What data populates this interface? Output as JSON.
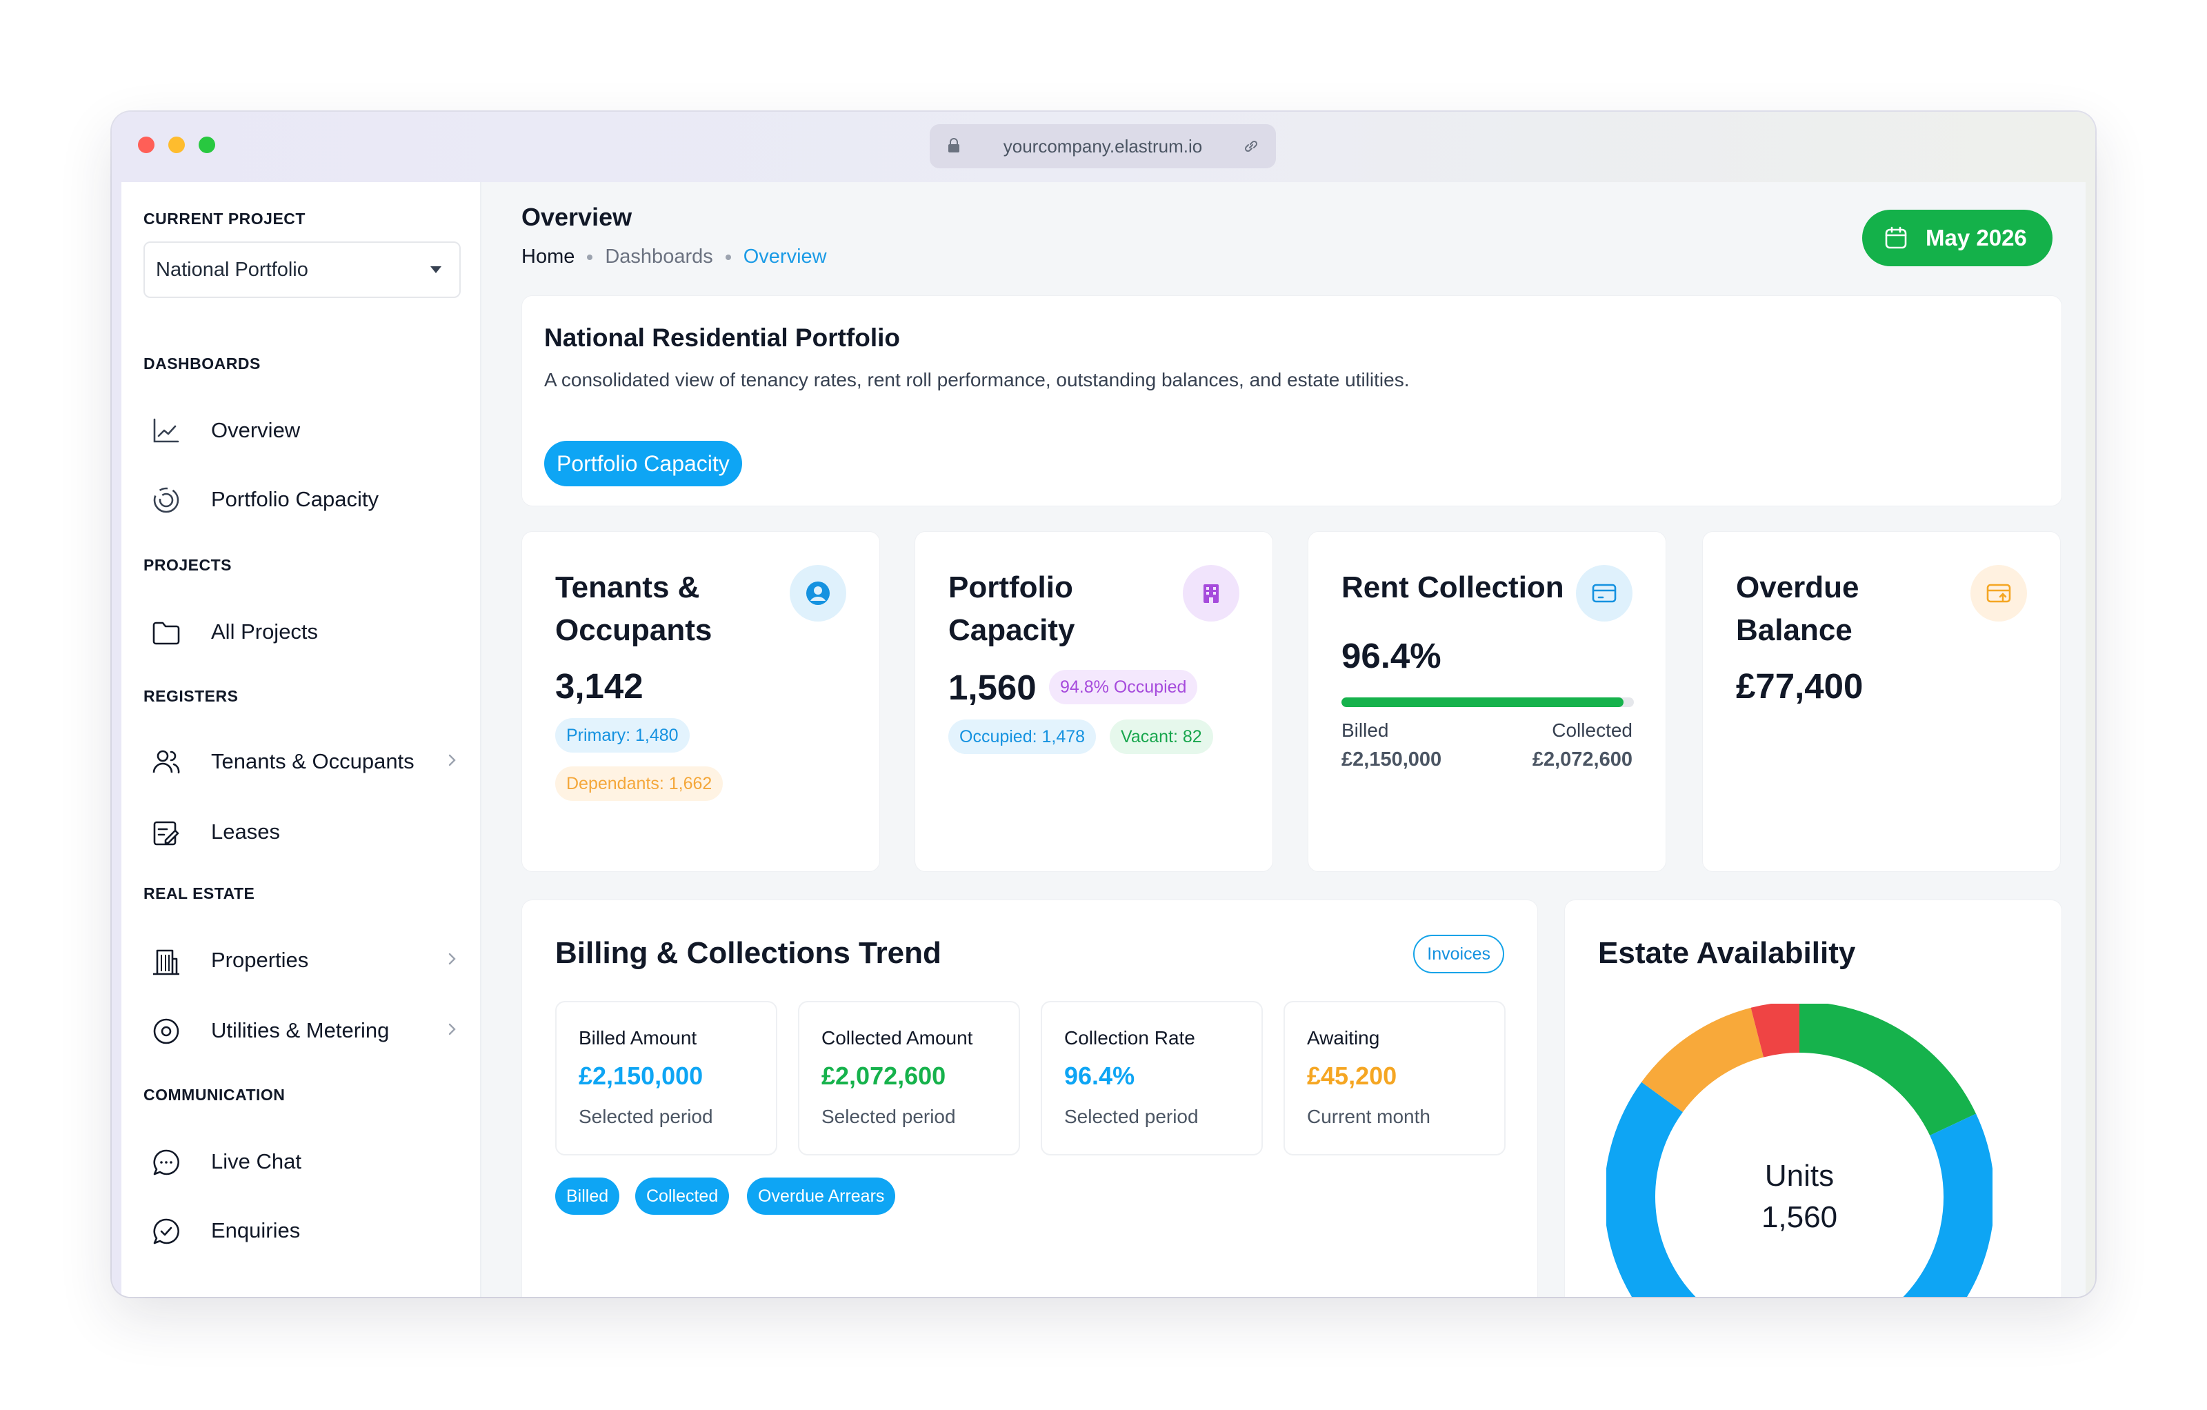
{
  "browser": {
    "url": "yourcompany.elastrum.io"
  },
  "sidebar": {
    "current_project_label": "CURRENT PROJECT",
    "project_value": "National Portfolio",
    "sections": {
      "dashboards": "DASHBOARDS",
      "projects": "PROJECTS",
      "registers": "REGISTERS",
      "real_estate": "REAL ESTATE",
      "communication": "COMMUNICATION"
    },
    "items": {
      "overview": "Overview",
      "portfolio_capacity": "Portfolio Capacity",
      "all_projects": "All Projects",
      "tenants": "Tenants & Occupants",
      "leases": "Leases",
      "properties": "Properties",
      "utilities": "Utilities & Metering",
      "live_chat": "Live Chat",
      "enquiries": "Enquiries"
    }
  },
  "header": {
    "title": "Overview",
    "breadcrumb": [
      "Home",
      "Dashboards",
      "Overview"
    ],
    "date_button": "May 2026"
  },
  "intro": {
    "title": "National Residential Portfolio",
    "description": "A consolidated view of tenancy rates, rent roll performance, outstanding balances, and estate utilities.",
    "pill": "Portfolio Capacity"
  },
  "stats": {
    "tenants": {
      "title_line1": "Tenants &",
      "title_line2": "Occupants",
      "value": "3,142",
      "primary": "Primary: 1,480",
      "dependants": "Dependants: 1,662"
    },
    "capacity": {
      "title_line1": "Portfolio",
      "title_line2": "Capacity",
      "value": "1,560",
      "occupied_pct": "94.8% Occupied",
      "occupied": "Occupied: 1,478",
      "vacant": "Vacant: 82"
    },
    "rent": {
      "title": "Rent Collection",
      "value": "96.4%",
      "progress": 96.4,
      "billed_label": "Billed",
      "billed_value": "£2,150,000",
      "collected_label": "Collected",
      "collected_value": "£2,072,600"
    },
    "overdue": {
      "title_line1": "Overdue",
      "title_line2": "Balance",
      "value": "£77,400"
    }
  },
  "billing": {
    "title": "Billing & Collections Trend",
    "invoices_button": "Invoices",
    "metrics": [
      {
        "label": "Billed Amount",
        "value": "£2,150,000",
        "sub": "Selected period",
        "color": "#0ea5f4"
      },
      {
        "label": "Collected Amount",
        "value": "£2,072,600",
        "sub": "Selected period",
        "color": "#16b24c"
      },
      {
        "label": "Collection Rate",
        "value": "96.4%",
        "sub": "Selected period",
        "color": "#0ea5f4"
      },
      {
        "label": "Awaiting",
        "value": "£45,200",
        "sub": "Current month",
        "color": "#f5a623"
      }
    ],
    "tags": [
      "Billed",
      "Collected",
      "Overdue Arrears"
    ]
  },
  "estate": {
    "title": "Estate Availability",
    "center_label": "Units",
    "center_value": "1,560",
    "segments": [
      {
        "color": "#16b24c",
        "value": 0.18
      },
      {
        "color": "#0ea5f4",
        "value": 0.67
      },
      {
        "color": "#f8a93a",
        "value": 0.11
      },
      {
        "color": "#ef4444",
        "value": 0.04
      }
    ]
  },
  "colors": {
    "accent": "#0ea5f4",
    "success": "#14b14a",
    "warning": "#f5a623",
    "danger": "#ef4444"
  }
}
